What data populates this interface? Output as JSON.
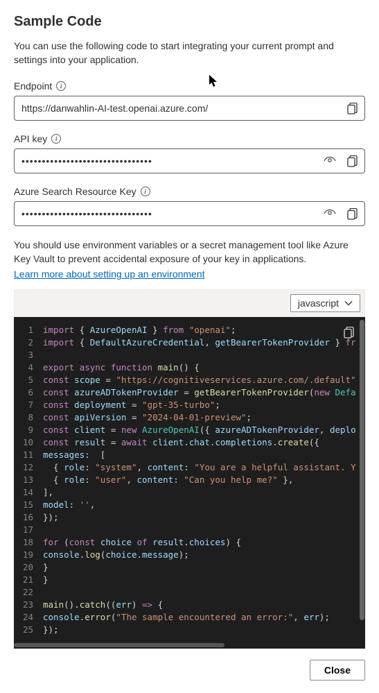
{
  "title": "Sample Code",
  "description": "You can use the following code to start integrating your current prompt and settings into your application.",
  "fields": {
    "endpoint": {
      "label": "Endpoint",
      "value": "https://danwahlin-AI-test.openai.azure.com/"
    },
    "api_key": {
      "label": "API key",
      "value": "••••••••••••••••••••••••••••••••"
    },
    "search_key": {
      "label": "Azure Search Resource Key",
      "value": "••••••••••••••••••••••••••••••••"
    }
  },
  "env_note": "You should use environment variables or a secret management tool like Azure Key Vault to prevent accidental exposure of your key in applications.",
  "env_link": "Learn more about setting up an environment",
  "language_selector": {
    "selected": "javascript"
  },
  "close_label": "Close",
  "code": {
    "lines": [
      {
        "n": 1,
        "t": [
          [
            "kw",
            "import"
          ],
          [
            "punc",
            " { "
          ],
          [
            "var",
            "AzureOpenAI"
          ],
          [
            "punc",
            " } "
          ],
          [
            "kw",
            "from"
          ],
          [
            "punc",
            " "
          ],
          [
            "str",
            "\"openai\""
          ],
          [
            "punc",
            ";"
          ]
        ]
      },
      {
        "n": 2,
        "t": [
          [
            "kw",
            "import"
          ],
          [
            "punc",
            " { "
          ],
          [
            "var",
            "DefaultAzureCredential"
          ],
          [
            "punc",
            ", "
          ],
          [
            "var",
            "getBearerTokenProvider"
          ],
          [
            "punc",
            " } "
          ],
          [
            "kw",
            "fr"
          ]
        ]
      },
      {
        "n": 3,
        "t": []
      },
      {
        "n": 4,
        "t": [
          [
            "kw",
            "export"
          ],
          [
            "punc",
            " "
          ],
          [
            "kw",
            "async"
          ],
          [
            "punc",
            " "
          ],
          [
            "kw",
            "function"
          ],
          [
            "punc",
            " "
          ],
          [
            "fn",
            "main"
          ],
          [
            "punc",
            "() {"
          ]
        ]
      },
      {
        "n": 5,
        "t": [
          [
            "kw",
            "const"
          ],
          [
            "punc",
            " "
          ],
          [
            "var",
            "scope"
          ],
          [
            "punc",
            " = "
          ],
          [
            "str",
            "\"https://cognitiveservices.azure.com/.default\""
          ]
        ]
      },
      {
        "n": 6,
        "t": [
          [
            "kw",
            "const"
          ],
          [
            "punc",
            " "
          ],
          [
            "var",
            "azureADTokenProvider"
          ],
          [
            "punc",
            " = "
          ],
          [
            "fn",
            "getBearerTokenProvider"
          ],
          [
            "punc",
            "("
          ],
          [
            "kw",
            "new"
          ],
          [
            "punc",
            " "
          ],
          [
            "type",
            "Defa"
          ]
        ]
      },
      {
        "n": 7,
        "t": [
          [
            "kw",
            "const"
          ],
          [
            "punc",
            " "
          ],
          [
            "var",
            "deployment"
          ],
          [
            "punc",
            " = "
          ],
          [
            "str",
            "\"gpt-35-turbo\""
          ],
          [
            "punc",
            ";"
          ]
        ]
      },
      {
        "n": 8,
        "t": [
          [
            "kw",
            "const"
          ],
          [
            "punc",
            " "
          ],
          [
            "var",
            "apiVersion"
          ],
          [
            "punc",
            " = "
          ],
          [
            "str",
            "\"2024-04-01-preview\""
          ],
          [
            "punc",
            ";"
          ]
        ]
      },
      {
        "n": 9,
        "t": [
          [
            "kw",
            "const"
          ],
          [
            "punc",
            " "
          ],
          [
            "var",
            "client"
          ],
          [
            "punc",
            " = "
          ],
          [
            "kw",
            "new"
          ],
          [
            "punc",
            " "
          ],
          [
            "type",
            "AzureOpenAI"
          ],
          [
            "punc",
            "({ "
          ],
          [
            "var",
            "azureADTokenProvider"
          ],
          [
            "punc",
            ", "
          ],
          [
            "var",
            "deplo"
          ]
        ]
      },
      {
        "n": 10,
        "t": [
          [
            "kw",
            "const"
          ],
          [
            "punc",
            " "
          ],
          [
            "var",
            "result"
          ],
          [
            "punc",
            " = "
          ],
          [
            "kw",
            "await"
          ],
          [
            "punc",
            " "
          ],
          [
            "var",
            "client"
          ],
          [
            "punc",
            "."
          ],
          [
            "var",
            "chat"
          ],
          [
            "punc",
            "."
          ],
          [
            "var",
            "completions"
          ],
          [
            "punc",
            "."
          ],
          [
            "fn",
            "create"
          ],
          [
            "punc",
            "({"
          ]
        ]
      },
      {
        "n": 11,
        "t": [
          [
            "prop",
            "messages"
          ],
          [
            "punc",
            ":  ["
          ]
        ]
      },
      {
        "n": 12,
        "t": [
          [
            "punc",
            "  { "
          ],
          [
            "prop",
            "role"
          ],
          [
            "punc",
            ": "
          ],
          [
            "str",
            "\"system\""
          ],
          [
            "punc",
            ", "
          ],
          [
            "prop",
            "content"
          ],
          [
            "punc",
            ": "
          ],
          [
            "str",
            "\"You are a helpful assistant. Y"
          ]
        ]
      },
      {
        "n": 13,
        "t": [
          [
            "punc",
            "  { "
          ],
          [
            "prop",
            "role"
          ],
          [
            "punc",
            ": "
          ],
          [
            "str",
            "\"user\""
          ],
          [
            "punc",
            ", "
          ],
          [
            "prop",
            "content"
          ],
          [
            "punc",
            ": "
          ],
          [
            "str",
            "\"Can you help me?\""
          ],
          [
            "punc",
            " },"
          ]
        ]
      },
      {
        "n": 14,
        "t": [
          [
            "punc",
            "],"
          ]
        ]
      },
      {
        "n": 15,
        "t": [
          [
            "prop",
            "model"
          ],
          [
            "punc",
            ": "
          ],
          [
            "str",
            "''"
          ],
          [
            "punc",
            ","
          ]
        ]
      },
      {
        "n": 16,
        "t": [
          [
            "punc",
            "});"
          ]
        ]
      },
      {
        "n": 17,
        "t": []
      },
      {
        "n": 18,
        "t": [
          [
            "kw",
            "for"
          ],
          [
            "punc",
            " ("
          ],
          [
            "kw",
            "const"
          ],
          [
            "punc",
            " "
          ],
          [
            "var",
            "choice"
          ],
          [
            "punc",
            " "
          ],
          [
            "kw",
            "of"
          ],
          [
            "punc",
            " "
          ],
          [
            "var",
            "result"
          ],
          [
            "punc",
            "."
          ],
          [
            "var",
            "choices"
          ],
          [
            "punc",
            ") {"
          ]
        ]
      },
      {
        "n": 19,
        "t": [
          [
            "var",
            "console"
          ],
          [
            "punc",
            "."
          ],
          [
            "fn",
            "log"
          ],
          [
            "punc",
            "("
          ],
          [
            "var",
            "choice"
          ],
          [
            "punc",
            "."
          ],
          [
            "var",
            "message"
          ],
          [
            "punc",
            ");"
          ]
        ]
      },
      {
        "n": 20,
        "t": [
          [
            "punc",
            "}"
          ]
        ]
      },
      {
        "n": 21,
        "t": [
          [
            "punc",
            "}"
          ]
        ]
      },
      {
        "n": 22,
        "t": []
      },
      {
        "n": 23,
        "t": [
          [
            "fn",
            "main"
          ],
          [
            "punc",
            "()."
          ],
          [
            "fn",
            "catch"
          ],
          [
            "punc",
            "(("
          ],
          [
            "var",
            "err"
          ],
          [
            "punc",
            ") "
          ],
          [
            "kw",
            "=>"
          ],
          [
            "punc",
            " {"
          ]
        ]
      },
      {
        "n": 24,
        "t": [
          [
            "var",
            "console"
          ],
          [
            "punc",
            "."
          ],
          [
            "fn",
            "error"
          ],
          [
            "punc",
            "("
          ],
          [
            "str",
            "\"The sample encountered an error:\""
          ],
          [
            "punc",
            ", "
          ],
          [
            "var",
            "err"
          ],
          [
            "punc",
            ");"
          ]
        ]
      },
      {
        "n": 25,
        "t": [
          [
            "punc",
            "});"
          ]
        ]
      }
    ]
  }
}
